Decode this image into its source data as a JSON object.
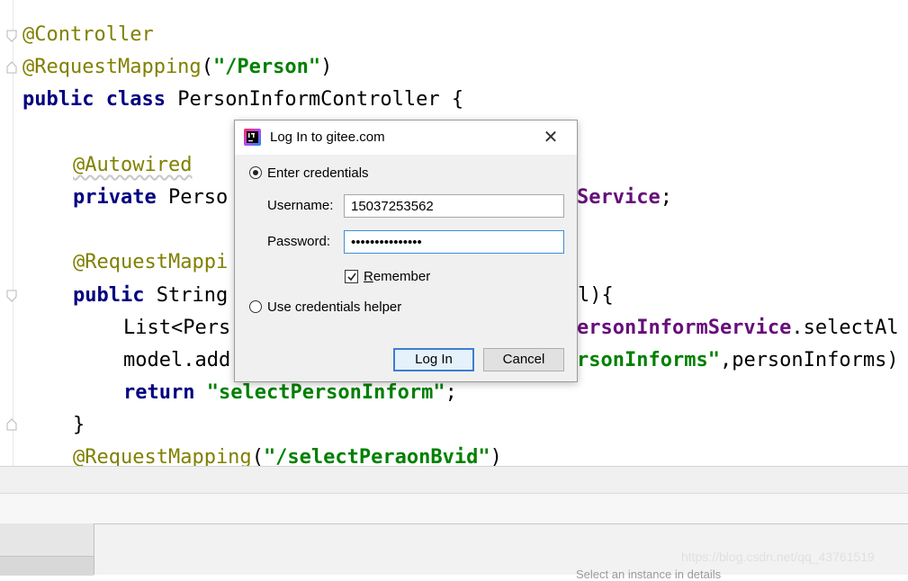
{
  "editor": {
    "lines": {
      "l1": {
        "ann": "@Controller"
      },
      "l2": {
        "ann": "@RequestMapping",
        "p1": "(",
        "str": "\"/Person\"",
        "p2": ")"
      },
      "l3": {
        "kw1": "public",
        "kw2": "class",
        "name": " PersonInformController {"
      },
      "l5": {
        "ann": "@Autowired"
      },
      "l6": {
        "kw": "private",
        "type": " Perso",
        "fld": "Service",
        "semi": ";"
      },
      "l8": {
        "ann": "@RequestMappi"
      },
      "l9": {
        "kw": "public",
        "type": " String",
        "tail": "l){"
      },
      "l10": {
        "pre": "List<Pers",
        "fld": "ersonInformService",
        "tail": ".selectAl"
      },
      "l11": {
        "pre": "model.add",
        "str": "rsonInforms\"",
        "tail": ",personInforms)"
      },
      "l12": {
        "kw": "return",
        "sp": " ",
        "str": "\"selectPersonInform\"",
        "semi": ";"
      },
      "l13": {
        "brace": "}"
      },
      "l14": {
        "ann": "@RequestMapping",
        "p1": "(",
        "str": "\"/selectPeraonBvid\"",
        "p2": ")"
      }
    }
  },
  "dialog": {
    "title": "Log In to gitee.com",
    "close_glyph": "✕",
    "option_credentials": "Enter credentials",
    "username_label": "Username:",
    "username_value": "15037253562",
    "password_label": "Password:",
    "password_value": "•••••••••••••••",
    "remember_label_first": "R",
    "remember_label_rest": "emember",
    "option_helper": "Use credentials helper",
    "login_label": "Log In",
    "cancel_label": "Cancel"
  },
  "footer": {
    "watermark": "https://blog.csdn.net/qq_43761519",
    "cut_text": "Select an instance in details"
  }
}
